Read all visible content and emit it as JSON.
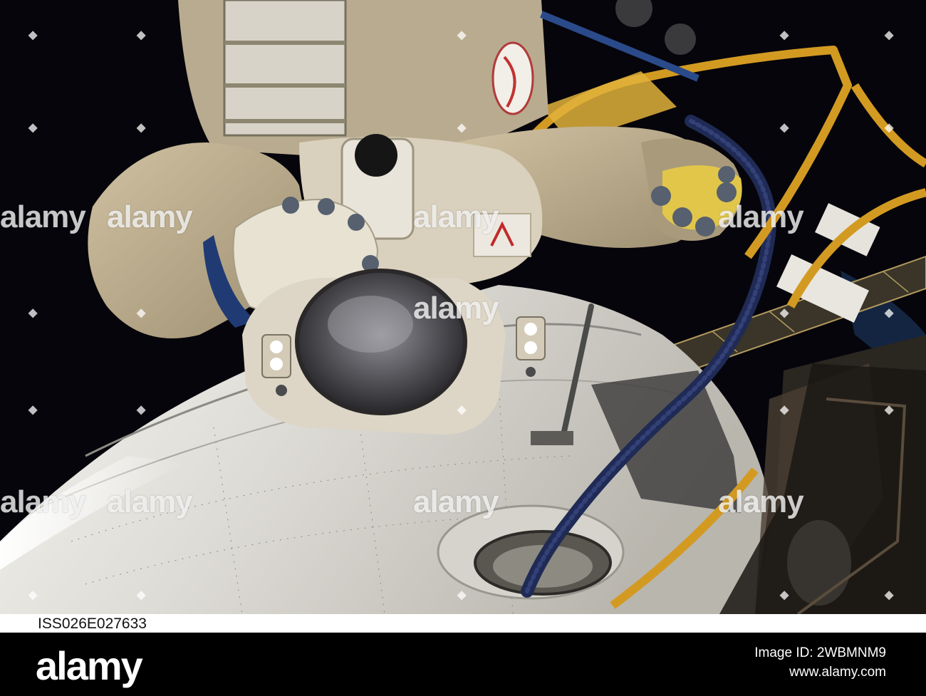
{
  "photo": {
    "caption": "ISS026E027633",
    "watermark_text": "alamy",
    "diamond_glyph": "◆"
  },
  "footer": {
    "logo": "alamy",
    "image_id_line": "Image ID: 2WBMNM9",
    "site_line": "www.alamy.com"
  }
}
